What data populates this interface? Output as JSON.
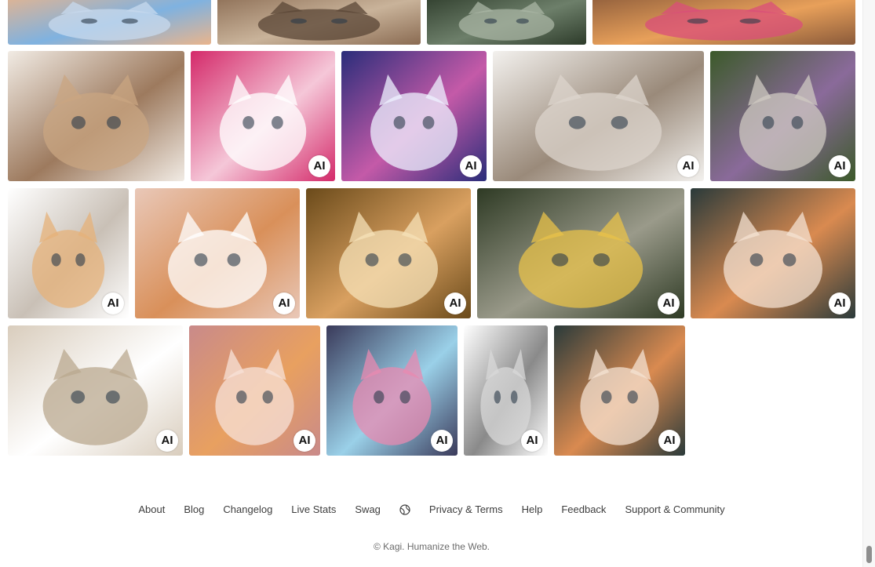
{
  "ai_badge_label": "AI",
  "rows": [
    {
      "images": [
        {
          "alt": "kitten on blue blanket",
          "ai": false,
          "colors": [
            "#e9b48c",
            "#7fb2e0",
            "#c8d9ee"
          ]
        },
        {
          "alt": "tabby kittens",
          "ai": false,
          "colors": [
            "#8a6b52",
            "#c9b39a",
            "#5a4535"
          ]
        },
        {
          "alt": "kitten in grass",
          "ai": false,
          "colors": [
            "#2d3b2a",
            "#6d7f6a",
            "#a9b5a4"
          ]
        },
        {
          "alt": "kittens with flowers",
          "ai": false,
          "colors": [
            "#8a5a3a",
            "#e8a05a",
            "#d94d7a"
          ]
        }
      ]
    },
    {
      "images": [
        {
          "alt": "sleeping tabby kitten",
          "ai": false,
          "colors": [
            "#f1ebe4",
            "#9d7a5e",
            "#caa581"
          ]
        },
        {
          "alt": "pink fluffy cartoon cat",
          "ai": true,
          "colors": [
            "#d42a6a",
            "#f5c7d8",
            "#ffffff"
          ]
        },
        {
          "alt": "white cartoon kitten night",
          "ai": true,
          "colors": [
            "#2a2d7a",
            "#c45aa8",
            "#eef2ff"
          ]
        },
        {
          "alt": "two sleeping kittens",
          "ai": true,
          "colors": [
            "#f3f1ee",
            "#9a8a7a",
            "#dcd4cc"
          ]
        },
        {
          "alt": "kitten with purple flowers",
          "ai": true,
          "colors": [
            "#3c5a2a",
            "#8a6a9a",
            "#cfc9c2"
          ]
        }
      ]
    },
    {
      "images": [
        {
          "alt": "four grey and orange kittens",
          "ai": true,
          "colors": [
            "#ffffff",
            "#c9c0b6",
            "#e6b27a"
          ]
        },
        {
          "alt": "orange white kitten lying",
          "ai": true,
          "colors": [
            "#e9c8b8",
            "#d9905a",
            "#ffffff"
          ]
        },
        {
          "alt": "orange kitten golden bokeh",
          "ai": true,
          "colors": [
            "#6a4a1a",
            "#d9a060",
            "#f6e2b8"
          ]
        },
        {
          "alt": "two kittens with daisies",
          "ai": true,
          "colors": [
            "#2e3a24",
            "#9a9a8a",
            "#e8c24a"
          ]
        },
        {
          "alt": "surprised tabby kitten",
          "ai": true,
          "colors": [
            "#2a3a3a",
            "#d98a50",
            "#f4e2d2"
          ]
        }
      ]
    },
    {
      "images": [
        {
          "alt": "white kitten blue eyes",
          "ai": true,
          "colors": [
            "#d9cdbd",
            "#ffffff",
            "#b9a88f"
          ]
        },
        {
          "alt": "kittens in pink basket",
          "ai": true,
          "colors": [
            "#c98a8a",
            "#e8a060",
            "#f7e2d8"
          ]
        },
        {
          "alt": "blue and pink kittens",
          "ai": true,
          "colors": [
            "#3a3a5a",
            "#9ad0e8",
            "#e88ab0"
          ]
        },
        {
          "alt": "kitten pencil sketch",
          "ai": true,
          "colors": [
            "#ffffff",
            "#8a8a8a",
            "#d8d8d8"
          ]
        },
        {
          "alt": "surprised tabby kitten",
          "ai": true,
          "colors": [
            "#2a3a3a",
            "#d98a50",
            "#f4e2d2"
          ]
        }
      ]
    }
  ],
  "footer": {
    "links": [
      "About",
      "Blog",
      "Changelog",
      "Live Stats",
      "Swag"
    ],
    "links_after_globe": [
      "Privacy & Terms",
      "Help",
      "Feedback",
      "Support & Community"
    ],
    "globe_icon": "globe-icon",
    "copyright": "© Kagi. Humanize the Web."
  }
}
